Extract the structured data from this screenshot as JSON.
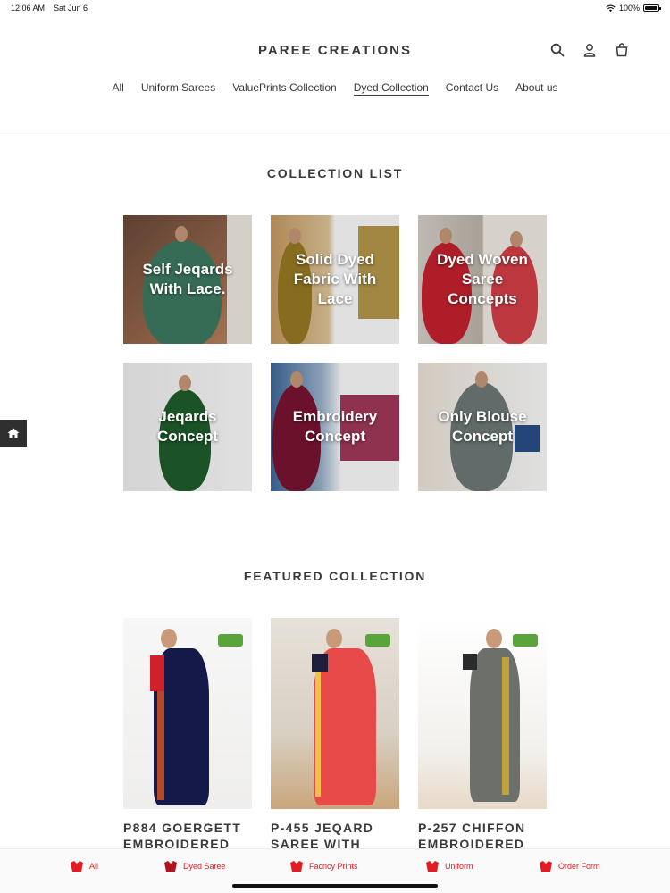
{
  "status_bar": {
    "time": "12:06 AM",
    "date": "Sat Jun 6",
    "battery": "100%"
  },
  "header": {
    "brand": "PAREE CREATIONS"
  },
  "nav": {
    "items": [
      {
        "label": "All"
      },
      {
        "label": "Uniform Sarees"
      },
      {
        "label": "ValuePrints Collection"
      },
      {
        "label": "Dyed Collection",
        "active": true
      },
      {
        "label": "Contact Us"
      },
      {
        "label": "About us"
      }
    ]
  },
  "collection_list": {
    "title": "COLLECTION LIST",
    "items": [
      {
        "label": "Self Jeqards With Lace."
      },
      {
        "label": "Solid Dyed Fabric With Lace"
      },
      {
        "label": "Dyed Woven Saree Concepts"
      },
      {
        "label": "Jeqards Concept"
      },
      {
        "label": "Embroidery Concept"
      },
      {
        "label": "Only Blouse Concept"
      }
    ]
  },
  "featured_collection": {
    "title": "FEATURED COLLECTION",
    "products": [
      {
        "title": "P884 GOERGETT EMBROIDERED"
      },
      {
        "title": "P-455 JEQARD SAREE WITH"
      },
      {
        "title": "P-257 CHIFFON EMBROIDERED"
      }
    ]
  },
  "bottom_nav": {
    "items": [
      {
        "label": "All"
      },
      {
        "label": "Dyed Saree"
      },
      {
        "label": "Facncy Prints"
      },
      {
        "label": "Uniform"
      },
      {
        "label": "Order Form"
      }
    ]
  },
  "colors": {
    "accent": "#e31b23",
    "text": "#3a3a3a",
    "home_tab": "#2f2f2f"
  },
  "icons": [
    "wifi-icon",
    "battery-icon",
    "search-icon",
    "account-icon",
    "cart-icon",
    "home-icon",
    "saree-icon"
  ]
}
